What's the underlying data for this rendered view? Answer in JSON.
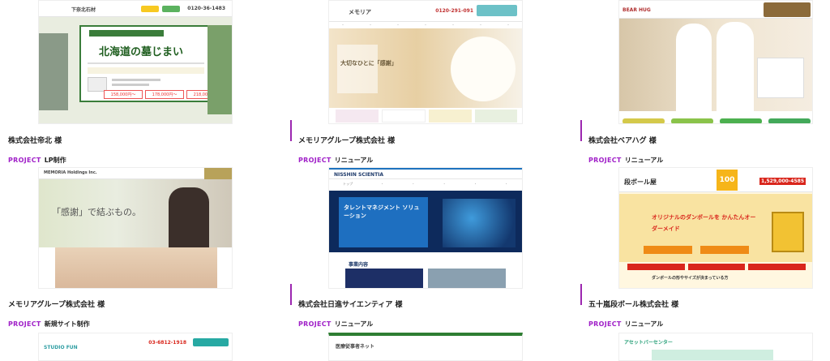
{
  "cards": [
    {
      "company": "株式会社帝北 様",
      "project_label": "PROJECT",
      "project_type": "LP制作",
      "shot": {
        "logo": "下奈北石材",
        "phone": "0120-36-1483",
        "headline": "北海道の墓じまい",
        "prices": [
          "158,000円〜",
          "178,000円〜",
          "218,000円〜"
        ]
      }
    },
    {
      "company": "メモリアグループ株式会社 様",
      "project_label": "PROJECT",
      "project_type": "リニューアル",
      "shot": {
        "logo": "メモリア",
        "phone": "0120-291-091",
        "headline": "大切なひとに「感謝」"
      }
    },
    {
      "company": "株式会社ベアハグ 様",
      "project_label": "PROJECT",
      "project_type": "リニューアル",
      "shot": {
        "logo": "BEAR HUG",
        "headline": ""
      }
    },
    {
      "company": "メモリアグループ株式会社 様",
      "project_label": "PROJECT",
      "project_type": "新規サイト制作",
      "shot": {
        "logo": "MEMORIA Holdings Inc.",
        "headline": "「感謝」で結ぶもの。"
      }
    },
    {
      "company": "株式会社日進サイエンティア 様",
      "project_label": "PROJECT",
      "project_type": "リニューアル",
      "shot": {
        "logo": "NISSHIN SCIENTIA",
        "headline": "タレントマネジメント ソリューション",
        "section": "事業内容"
      }
    },
    {
      "company": "五十嵐段ボール株式会社 様",
      "project_label": "PROJECT",
      "project_type": "リニューアル",
      "shot": {
        "logo": "段ボール屋",
        "phone": "1,529,000-4585",
        "badge": "100",
        "headline": "オリジナルのダンボールを かんたんオーダーメイド",
        "footer": "ダンボールの形やサイズが決まっている方"
      }
    },
    {
      "shot": {
        "logo": "STUDIO FUN",
        "phone": "03-6812-1918"
      }
    },
    {
      "shot": {
        "logo": "医療従事者ネット"
      }
    },
    {
      "shot": {
        "logo": "アセットバーセンター"
      }
    }
  ],
  "colors": {
    "accent": "#a020c8",
    "divider": "#9c27b0"
  }
}
